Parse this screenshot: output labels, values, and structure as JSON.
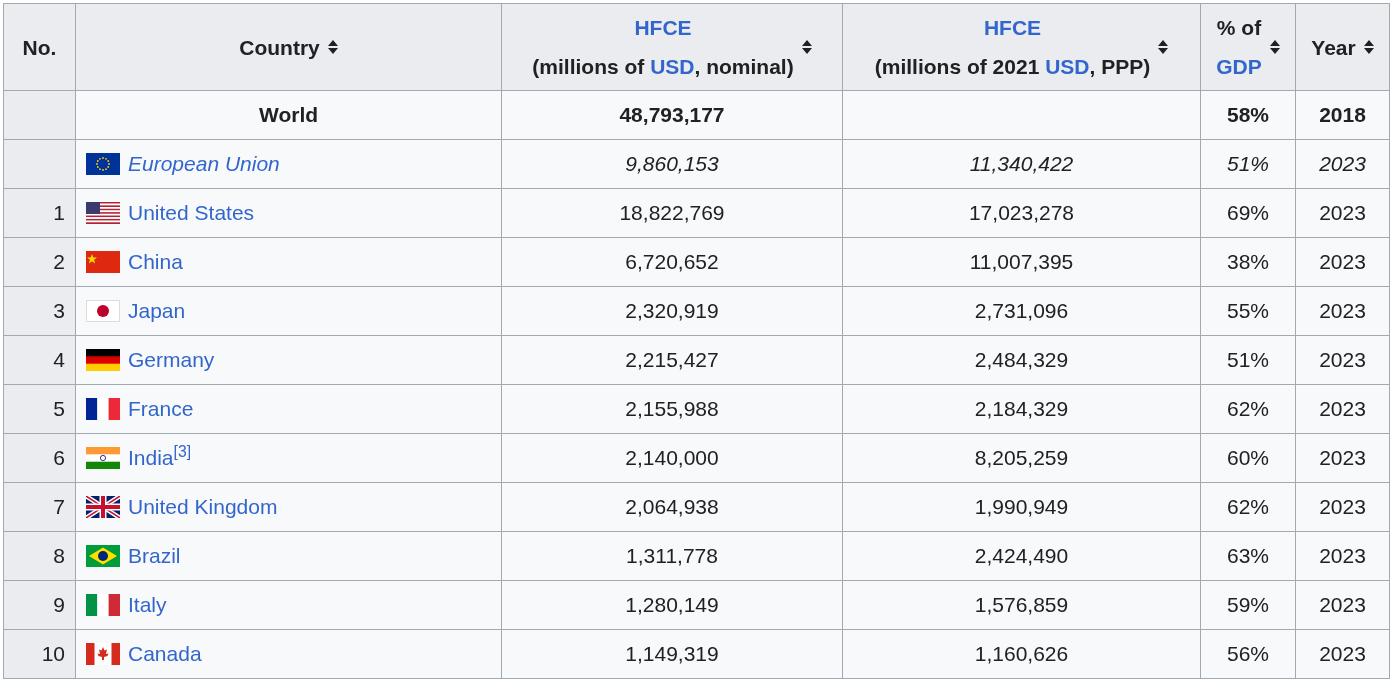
{
  "table": {
    "columns": [
      {
        "lines": [
          [
            {
              "text": "No.",
              "link": false
            }
          ]
        ],
        "sortable": false
      },
      {
        "lines": [
          [
            {
              "text": "Country",
              "link": false
            }
          ]
        ],
        "sortable": true
      },
      {
        "lines": [
          [
            {
              "text": "HFCE",
              "link": true
            }
          ],
          [
            {
              "text": "(millions of ",
              "link": false
            },
            {
              "text": "USD",
              "link": true
            },
            {
              "text": ", nominal)",
              "link": false
            }
          ]
        ],
        "sortable": true
      },
      {
        "lines": [
          [
            {
              "text": "HFCE",
              "link": true
            }
          ],
          [
            {
              "text": "(millions of 2021 ",
              "link": false
            },
            {
              "text": "USD",
              "link": true
            },
            {
              "text": ", PPP)",
              "link": false
            }
          ]
        ],
        "sortable": true
      },
      {
        "lines": [
          [
            {
              "text": "% of",
              "link": false
            }
          ],
          [
            {
              "text": "GDP",
              "link": true
            }
          ]
        ],
        "sortable": true
      },
      {
        "lines": [
          [
            {
              "text": "Year",
              "link": false
            }
          ]
        ],
        "sortable": true
      }
    ],
    "rows": [
      {
        "kind": "total",
        "no": "",
        "country": "World",
        "nominal": "48,793,177",
        "ppp": "",
        "gdp": "58%",
        "year": "2018"
      },
      {
        "kind": "aggregate",
        "flag": {
          "kind": "eu"
        },
        "no": "",
        "country": "European Union",
        "nominal": "9,860,153",
        "ppp": "11,340,422",
        "gdp": "51%",
        "year": "2023"
      },
      {
        "kind": "country",
        "flag": {
          "kind": "us"
        },
        "no": "1",
        "country": "United States",
        "nominal": "18,822,769",
        "ppp": "17,023,278",
        "gdp": "69%",
        "year": "2023"
      },
      {
        "kind": "country",
        "flag": {
          "kind": "cn"
        },
        "no": "2",
        "country": "China",
        "nominal": "6,720,652",
        "ppp": "11,007,395",
        "gdp": "38%",
        "year": "2023"
      },
      {
        "kind": "country",
        "flag": {
          "kind": "jp"
        },
        "no": "3",
        "country": "Japan",
        "nominal": "2,320,919",
        "ppp": "2,731,096",
        "gdp": "55%",
        "year": "2023"
      },
      {
        "kind": "country",
        "flag": {
          "kind": "de"
        },
        "no": "4",
        "country": "Germany",
        "nominal": "2,215,427",
        "ppp": "2,484,329",
        "gdp": "51%",
        "year": "2023"
      },
      {
        "kind": "country",
        "flag": {
          "kind": "fr"
        },
        "no": "5",
        "country": "France",
        "nominal": "2,155,988",
        "ppp": "2,184,329",
        "gdp": "62%",
        "year": "2023"
      },
      {
        "kind": "country",
        "flag": {
          "kind": "in"
        },
        "no": "6",
        "country": "India$^{[3]}$",
        "nominal": "2,140,000",
        "ppp": "8,205,259",
        "gdp": "60%",
        "year": "2023"
      },
      {
        "kind": "country",
        "flag": {
          "kind": "gb"
        },
        "no": "7",
        "country": "United Kingdom",
        "nominal": "2,064,938",
        "ppp": "1,990,949",
        "gdp": "62%",
        "year": "2023"
      },
      {
        "kind": "country",
        "flag": {
          "kind": "br"
        },
        "no": "8",
        "country": "Brazil",
        "nominal": "1,311,778",
        "ppp": "2,424,490",
        "gdp": "63%",
        "year": "2023"
      },
      {
        "kind": "country",
        "flag": {
          "kind": "it"
        },
        "no": "9",
        "country": "Italy",
        "nominal": "1,280,149",
        "ppp": "1,576,859",
        "gdp": "59%",
        "year": "2023"
      },
      {
        "kind": "country",
        "flag": {
          "kind": "ca"
        },
        "no": "10",
        "country": "Canada",
        "nominal": "1,149,319",
        "ppp": "1,160,626",
        "gdp": "56%",
        "year": "2023"
      }
    ]
  }
}
